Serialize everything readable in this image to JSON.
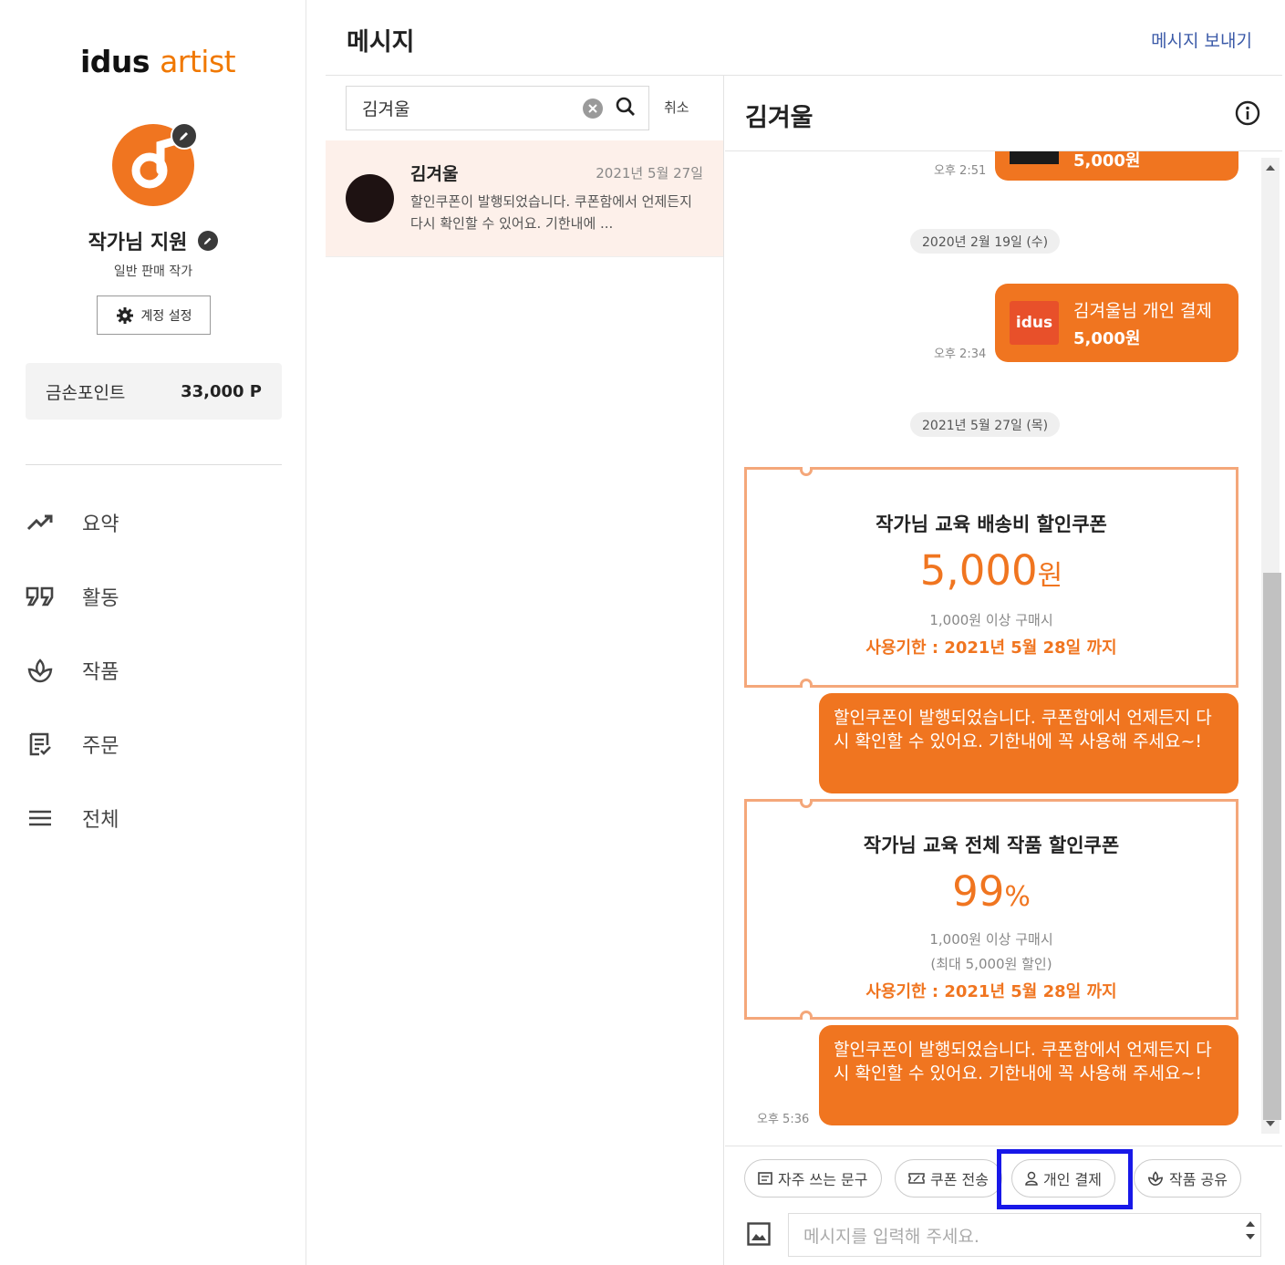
{
  "brand": {
    "logo_idus": "idus",
    "logo_artist": "artist",
    "accent": "#f07520"
  },
  "profile": {
    "name": "작가님 지원",
    "role": "일반 판매 작가",
    "settings_label": "계정 설정"
  },
  "points": {
    "label": "금손포인트",
    "value": "33,000 P"
  },
  "nav": [
    {
      "icon": "trending-up-icon",
      "label": "요약"
    },
    {
      "icon": "quote-icon",
      "label": "활동"
    },
    {
      "icon": "leaf-icon",
      "label": "작품"
    },
    {
      "icon": "order-list-icon",
      "label": "주문"
    },
    {
      "icon": "menu-icon",
      "label": "전체"
    }
  ],
  "header": {
    "title": "메시지",
    "send_message": "메시지 보내기"
  },
  "search": {
    "value": "김겨울",
    "cancel": "취소"
  },
  "conversations": [
    {
      "name": "김겨울",
      "date": "2021년 5월 27일",
      "preview": "할인쿠폰이 발행되었습니다. 쿠폰함에서 언제든지 다시 확인할 수 있어요. 기한내에 ..."
    }
  ],
  "chat": {
    "name": "김겨울",
    "top_bubble": {
      "amount": "5,000원",
      "time": "오후 2:51"
    },
    "date_1": "2020년 2월 19일 (수)",
    "payment": {
      "title": "김겨울님 개인 결제",
      "amount": "5,000원",
      "time": "오후 2:34",
      "logo": "idus"
    },
    "date_2": "2021년 5월 27일 (목)",
    "coupon_1": {
      "title": "작가님 교육 배송비 할인쿠폰",
      "amount": "5,000",
      "unit": "원",
      "condition": "1,000원 이상 구매시",
      "expire": "사용기한 : 2021년 5월 28일 까지"
    },
    "message_1": "할인쿠폰이 발행되었습니다. 쿠폰함에서 언제든지 다시 확인할 수 있어요. 기한내에 꼭 사용해 주세요~!",
    "coupon_2": {
      "title": "작가님 교육 전체 작품 할인쿠폰",
      "amount": "99",
      "unit": "%",
      "condition": "1,000원 이상 구매시",
      "condition_2": "(최대 5,000원 할인)",
      "expire": "사용기한 : 2021년 5월 28일 까지"
    },
    "message_2": "할인쿠폰이 발행되었습니다. 쿠폰함에서 언제든지 다시 확인할 수 있어요. 기한내에 꼭 사용해 주세요~!",
    "message_2_time": "오후 5:36"
  },
  "composer": {
    "chips": [
      {
        "icon": "phrase-icon",
        "label": "자주 쓰는 문구"
      },
      {
        "icon": "coupon-icon",
        "label": "쿠폰 전송"
      },
      {
        "icon": "person-icon",
        "label": "개인 결제"
      },
      {
        "icon": "leaf-icon",
        "label": "작품 공유"
      }
    ],
    "placeholder": "메시지를 입력해 주세요."
  }
}
